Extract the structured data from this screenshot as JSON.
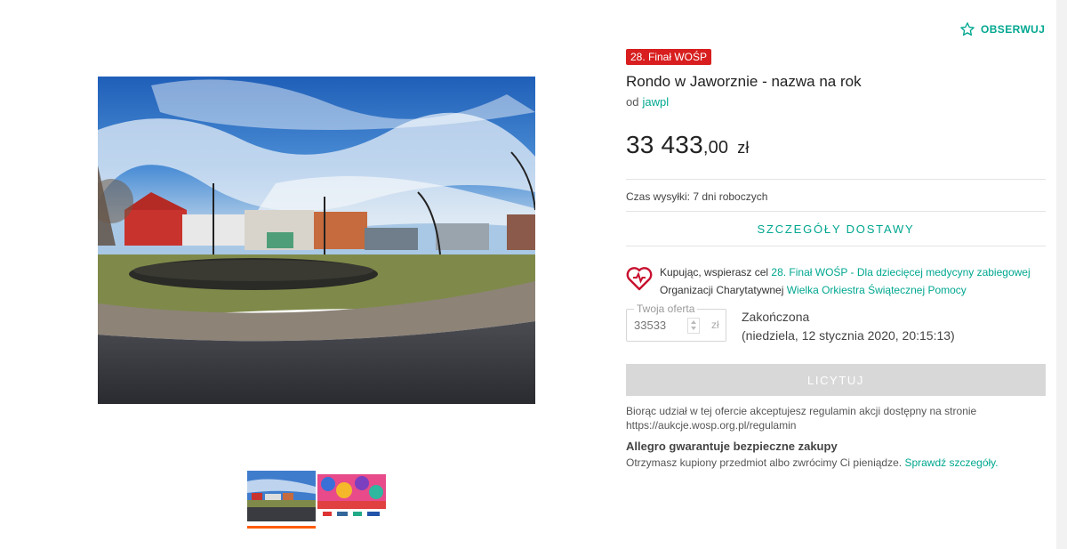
{
  "header": {
    "observe_label": "OBSERWUJ",
    "observe_icon": "star-outline-icon"
  },
  "gallery": {
    "main_image_alt": "roundabout-photo",
    "thumbnails": [
      {
        "name": "thumb-roundabout",
        "active": true
      },
      {
        "name": "thumb-wosp-poster",
        "active": false
      }
    ]
  },
  "listing": {
    "badge": "28. Finał WOŚP",
    "title": "Rondo w Jaworznie - nazwa na rok",
    "seller_prefix": "od",
    "seller_name": "jawpl",
    "price_int": "33 433",
    "price_dec": ",00",
    "price_currency": "zł"
  },
  "shipping": {
    "time_label": "Czas wysyłki: 7 dni roboczych",
    "details_button": "SZCZEGÓŁY DOSTAWY"
  },
  "charity": {
    "icon": "heart-icon",
    "text_prefix": "Kupując, wspierasz cel ",
    "goal_link": "28. Finał WOŚP - Dla dziecięcej medycyny zabiegowej",
    "org_prefix": "Organizacji Charytatywnej ",
    "org_link": "Wielka Orkiestra Świątecznej Pomocy"
  },
  "offer": {
    "legend": "Twoja oferta",
    "placeholder": "33533",
    "unit": "zł",
    "status": "Zakończona",
    "ended_date": "(niedziela, 12 stycznia 2020, 20:15:13)",
    "bid_button": "LICYTUJ"
  },
  "terms": {
    "line1": "Biorąc udział w tej ofercie akceptujesz regulamin akcji dostępny na stronie",
    "line2": "https://aukcje.wosp.org.pl/regulamin"
  },
  "guarantee": {
    "title": "Allegro gwarantuje bezpieczne zakupy",
    "text": "Otrzymasz kupiony przedmiot albo zwrócimy Ci pieniądze. ",
    "link": "Sprawdź szczegóły."
  },
  "colors": {
    "accent": "#00a790",
    "badge": "#d81e1e",
    "underline": "#ff5a00",
    "disabled": "#d8d8d8"
  }
}
